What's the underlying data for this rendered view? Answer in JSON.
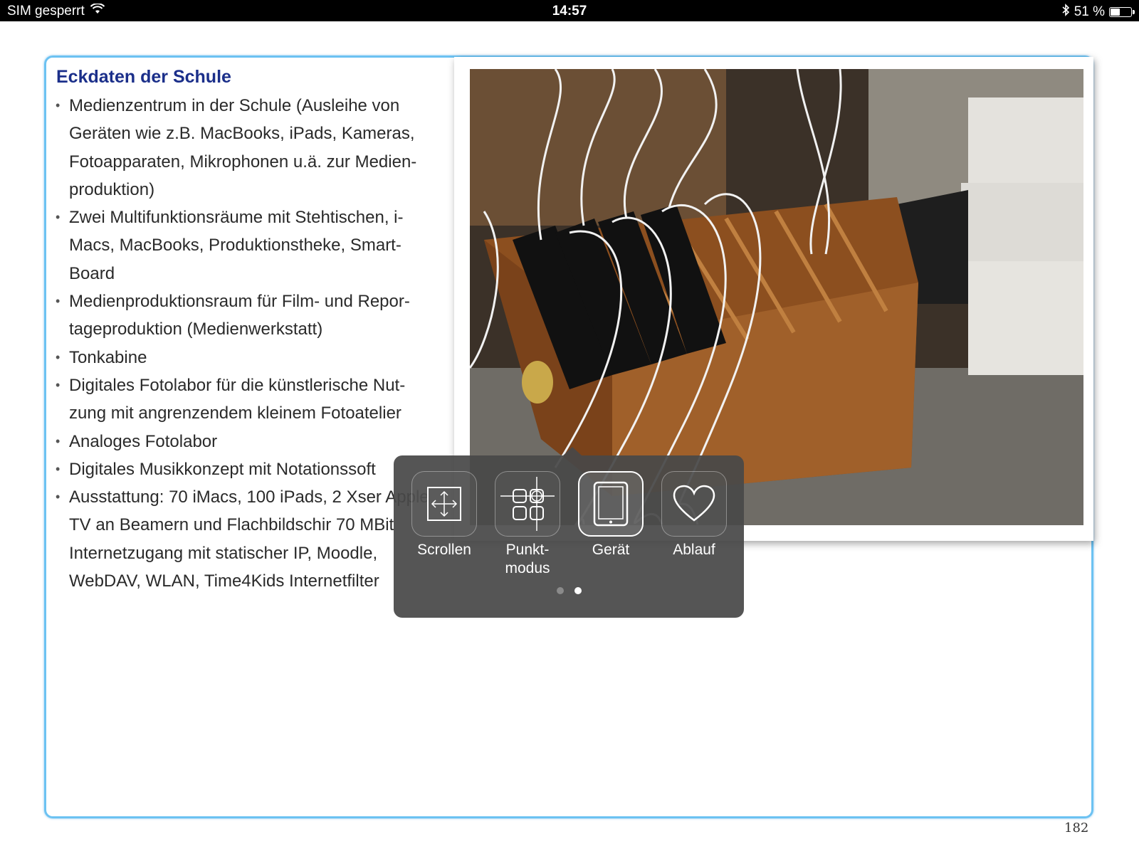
{
  "status_bar": {
    "carrier": "SIM gesperrt",
    "time": "14:57",
    "battery": "51 %",
    "battery_level": 0.51,
    "icons": [
      "wifi-icon",
      "bluetooth-icon",
      "battery-icon"
    ]
  },
  "page": {
    "heading": "Eckdaten der Schule",
    "heading_color": "#1b2f8a",
    "frame_color": "#6cc2f2",
    "bullets": [
      "Medienzentrum in der Schule (Ausleihe von Geräten wie z.B. MacBooks, iPads, Kameras, Fotoapparaten, Mikrophonen u.ä. zur Medien-produktion)",
      "Zwei Multifunktionsräume mit Stehtischen, i-Macs, MacBooks, Produktionstheke, Smart-Board",
      "Medienproduktionsraum für Film- und Repor-tageproduktion (Medienwerkstatt)",
      "Tonkabine",
      "Digitales Fotolabor für die künstlerische Nut-zung mit angrenzendem kleinem Fotoatelier",
      "Analoges Fotolabor",
      "Digitales Musikkonzept mit Notationssoft",
      "Ausstattung: 70 iMacs, 100 iPads, 2 Xser Apple TV an Beamern und Flachbildschir 70 MBit Internetzugang mit statischer IP, Moodle, WebDAV, WLAN, Time4Kids Internetfilter"
    ],
    "photo": "wooden-charging-rack-photo",
    "page_number": "182"
  },
  "assistive_menu": {
    "items": [
      {
        "label": "Scrollen",
        "icon": "scroll-arrows-icon"
      },
      {
        "label": "Punkt-\nmodus",
        "icon": "point-mode-icon"
      },
      {
        "label": "Gerät",
        "icon": "device-icon"
      },
      {
        "label": "Ablauf",
        "icon": "heart-icon"
      }
    ],
    "active": "Gerät",
    "page_indicator": {
      "count": 2,
      "current": 2
    }
  }
}
